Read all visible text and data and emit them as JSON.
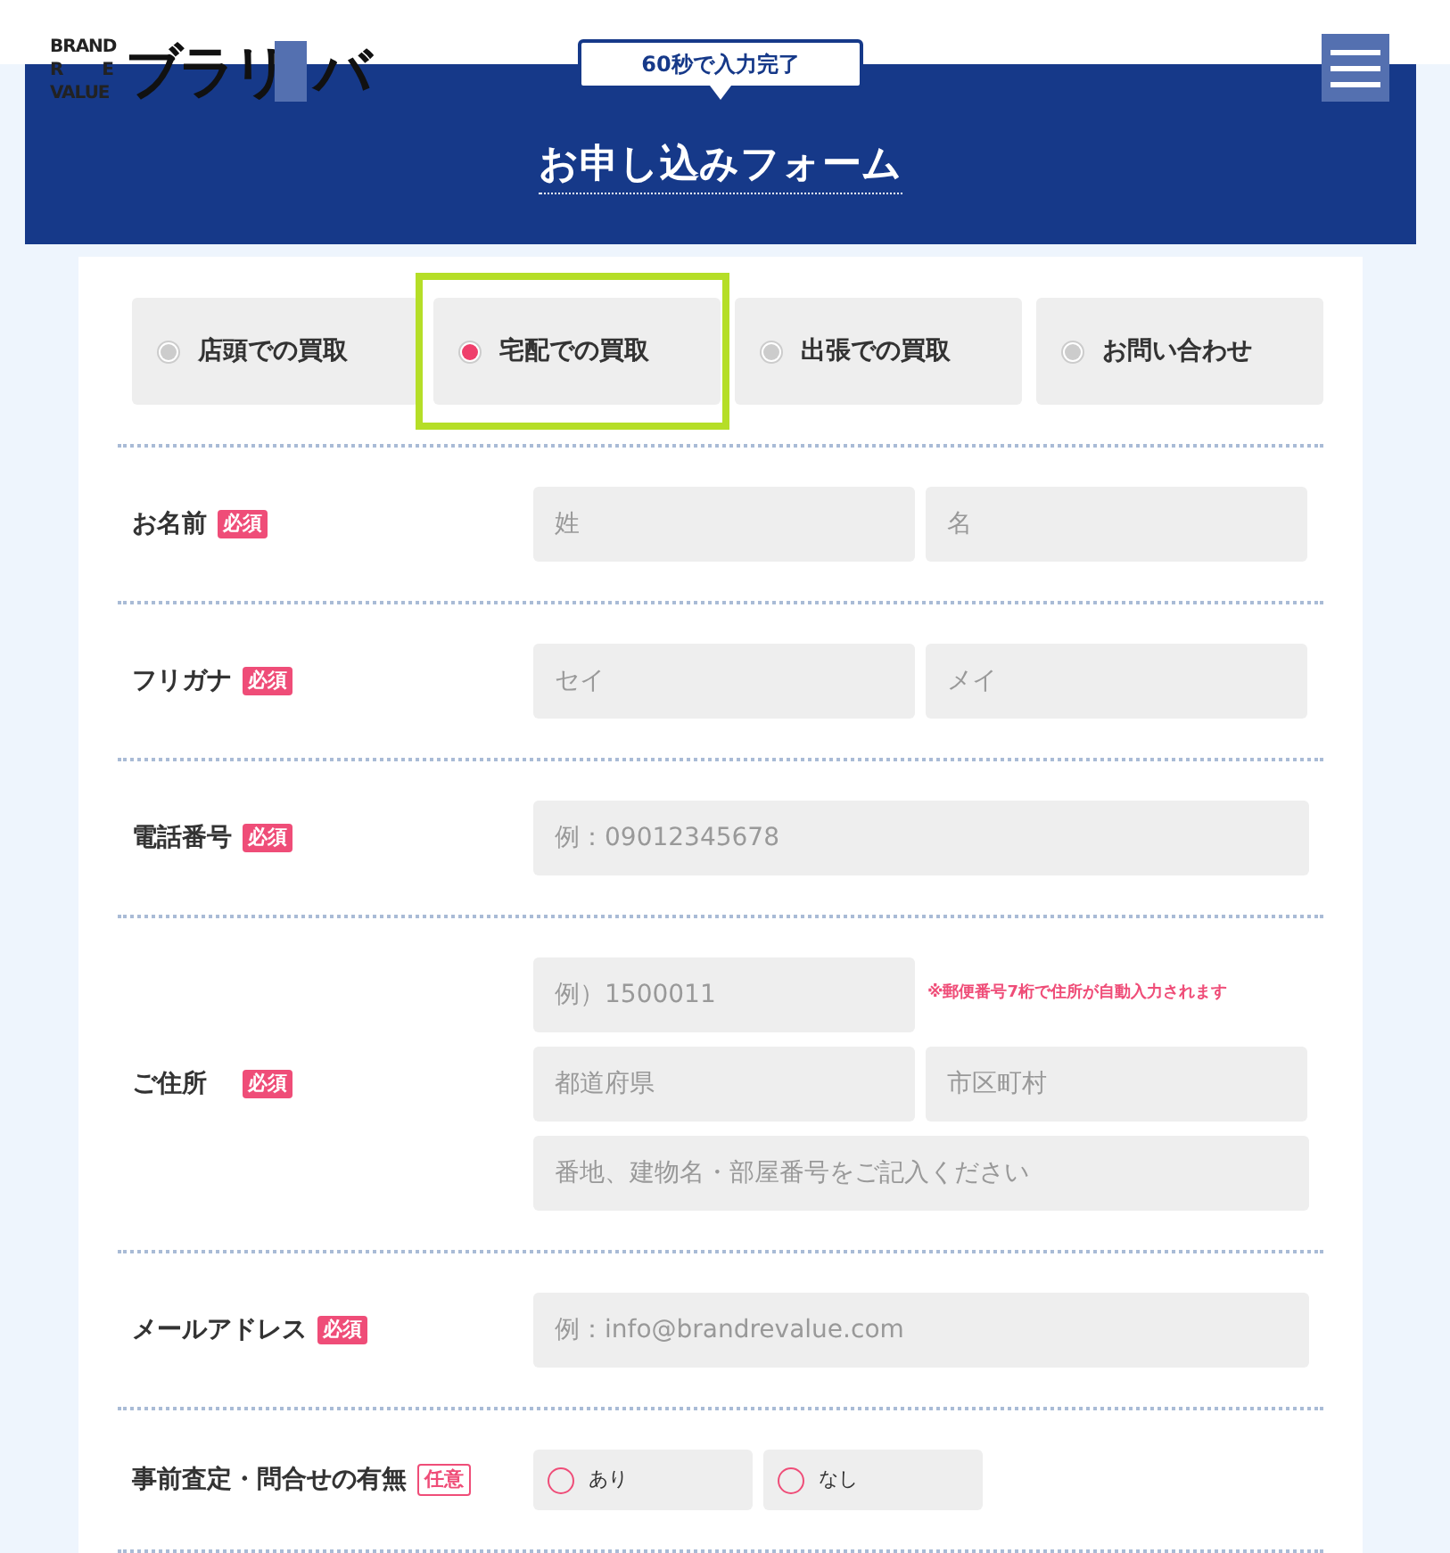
{
  "logo": {
    "letters": [
      "BRAND",
      "R",
      "E",
      "VALUE"
    ],
    "mark_before": "ブラリ",
    "mark_after": "バ"
  },
  "speech_badge": "60秒で入力完了",
  "title": "お申し込みフォーム",
  "purchase_types": [
    {
      "label": "店頭での買取",
      "selected": false,
      "highlighted": false
    },
    {
      "label": "宅配での買取",
      "selected": true,
      "highlighted": true
    },
    {
      "label": "出張での買取",
      "selected": false,
      "highlighted": false
    },
    {
      "label": "お問い合わせ",
      "selected": false,
      "highlighted": false
    }
  ],
  "rows": [
    {
      "label": "お名前",
      "badge": {
        "text": "必須",
        "kind": "required"
      },
      "lines": [
        [
          {
            "kind": "input",
            "placeholder": "姓"
          },
          {
            "kind": "input",
            "placeholder": "名"
          }
        ]
      ]
    },
    {
      "label": "フリガナ",
      "badge": {
        "text": "必須",
        "kind": "required"
      },
      "lines": [
        [
          {
            "kind": "input",
            "placeholder": "セイ"
          },
          {
            "kind": "input",
            "placeholder": "メイ"
          }
        ]
      ]
    },
    {
      "label": "電話番号",
      "badge": {
        "text": "必須",
        "kind": "required"
      },
      "lines": [
        [
          {
            "kind": "input",
            "placeholder": "例：09012345678"
          }
        ]
      ]
    },
    {
      "label": "ご住所",
      "badge": {
        "text": "必須",
        "kind": "required"
      },
      "lines": [
        [
          {
            "kind": "input",
            "placeholder": "例）1500011"
          },
          {
            "kind": "note",
            "text": "※郵便番号7桁で住所が自動入力されます"
          }
        ],
        [
          {
            "kind": "input",
            "placeholder": "都道府県"
          },
          {
            "kind": "input",
            "placeholder": "市区町村"
          }
        ],
        [
          {
            "kind": "input",
            "placeholder": "番地、建物名・部屋番号をご記入ください"
          }
        ]
      ]
    },
    {
      "label": "メールアドレス",
      "badge": {
        "text": "必須",
        "kind": "required"
      },
      "lines": [
        [
          {
            "kind": "input",
            "placeholder": "例：info@brandrevalue.com"
          }
        ]
      ]
    },
    {
      "label": "事前査定・問合せの有無",
      "badge": {
        "text": "任意",
        "kind": "optional"
      },
      "lines": [
        [
          {
            "kind": "radio",
            "label": "あり",
            "checked": false
          },
          {
            "kind": "radio",
            "label": "なし",
            "checked": false
          }
        ]
      ]
    }
  ]
}
